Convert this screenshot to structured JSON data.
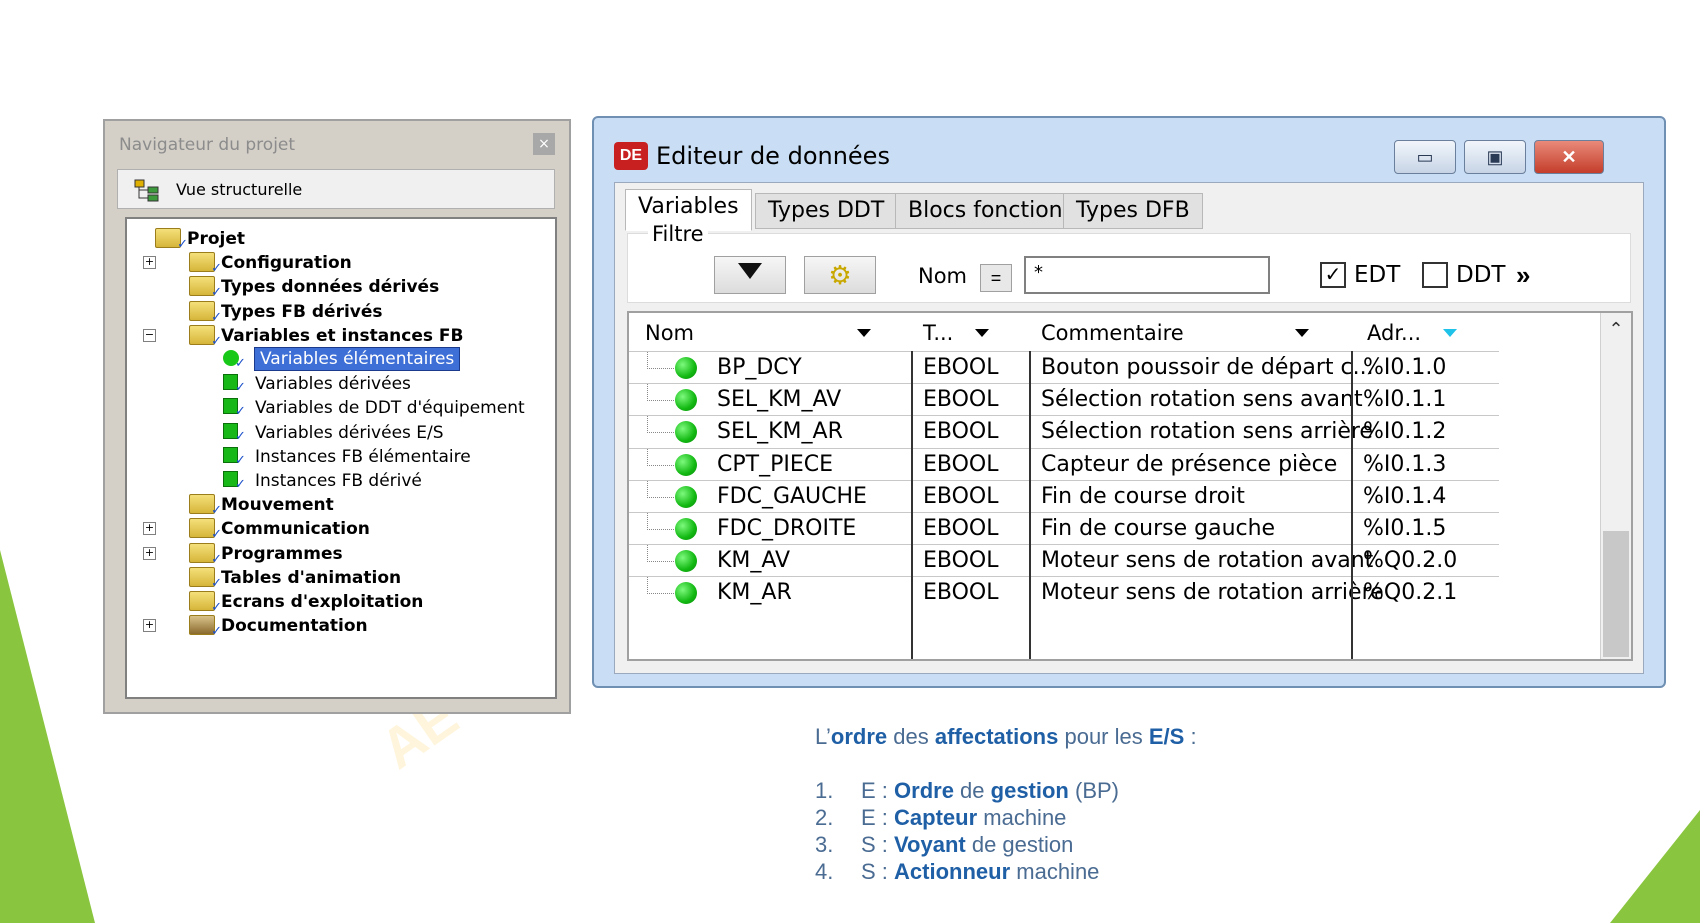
{
  "navigator": {
    "title": "Navigateur du projet",
    "close": "×",
    "view": "Vue structurelle",
    "tree": [
      {
        "label": "Projet",
        "bold": true,
        "level": 0,
        "icon": "folder-icon",
        "expander": ""
      },
      {
        "label": "Configuration",
        "bold": true,
        "level": 1,
        "icon": "folder-icon",
        "expander": "+"
      },
      {
        "label": "Types données dérivés",
        "bold": true,
        "level": 1,
        "icon": "folder-icon",
        "expander": ""
      },
      {
        "label": "Types FB dérivés",
        "bold": true,
        "level": 1,
        "icon": "folder-icon",
        "expander": ""
      },
      {
        "label": "Variables et instances FB",
        "bold": true,
        "level": 1,
        "icon": "folder-icon",
        "expander": "−"
      },
      {
        "label": "Variables élémentaires",
        "bold": false,
        "level": 2,
        "icon": "green-ball-icon",
        "selected": true
      },
      {
        "label": "Variables dérivées",
        "bold": false,
        "level": 2,
        "icon": "green-block-icon"
      },
      {
        "label": "Variables de DDT d'équipement",
        "bold": false,
        "level": 2,
        "icon": "green-block-icon"
      },
      {
        "label": "Variables dérivées E/S",
        "bold": false,
        "level": 2,
        "icon": "green-io-icon"
      },
      {
        "label": "Instances FB élémentaire",
        "bold": false,
        "level": 2,
        "icon": "green-fb-icon"
      },
      {
        "label": "Instances FB dérivé",
        "bold": false,
        "level": 2,
        "icon": "green-fb-icon"
      },
      {
        "label": "Mouvement",
        "bold": true,
        "level": 1,
        "icon": "folder-icon",
        "expander": ""
      },
      {
        "label": "Communication",
        "bold": true,
        "level": 1,
        "icon": "folder-icon",
        "expander": "+"
      },
      {
        "label": "Programmes",
        "bold": true,
        "level": 1,
        "icon": "folder-icon",
        "expander": "+"
      },
      {
        "label": "Tables d'animation",
        "bold": true,
        "level": 1,
        "icon": "folder-icon",
        "expander": ""
      },
      {
        "label": "Ecrans d'exploitation",
        "bold": true,
        "level": 1,
        "icon": "folder-icon",
        "expander": ""
      },
      {
        "label": "Documentation",
        "bold": true,
        "level": 1,
        "icon": "documentation-icon",
        "expander": "+"
      }
    ]
  },
  "editor": {
    "title": "Editeur de données",
    "app_icon": "DE",
    "buttons": {
      "minimize": "▭",
      "maximize": "▣",
      "close": "✕"
    },
    "tabs": [
      "Variables",
      "Types DDT",
      "Blocs fonction",
      "Types DFB"
    ],
    "filter": {
      "label": "Filtre",
      "nom_label": "Nom",
      "eq": "=",
      "value": "*",
      "edt_label": "EDT",
      "edt_checked": true,
      "ddt_label": "DDT",
      "ddt_checked": false,
      "more": "»"
    },
    "columns": [
      "Nom",
      "T...",
      "Commentaire",
      "Adr..."
    ],
    "rows": [
      {
        "name": "BP_DCY",
        "type": "EBOOL",
        "comment": "Bouton poussoir de départ c...",
        "addr": "%I0.1.0"
      },
      {
        "name": "SEL_KM_AV",
        "type": "EBOOL",
        "comment": "Sélection rotation sens avant",
        "addr": "%I0.1.1"
      },
      {
        "name": "SEL_KM_AR",
        "type": "EBOOL",
        "comment": "Sélection rotation sens arrière",
        "addr": "%I0.1.2"
      },
      {
        "name": "CPT_PIECE",
        "type": "EBOOL",
        "comment": "Capteur de présence pièce",
        "addr": "%I0.1.3"
      },
      {
        "name": "FDC_GAUCHE",
        "type": "EBOOL",
        "comment": "Fin de course droit",
        "addr": "%I0.1.4"
      },
      {
        "name": "FDC_DROITE",
        "type": "EBOOL",
        "comment": "Fin de course gauche",
        "addr": "%I0.1.5"
      },
      {
        "name": "KM_AV",
        "type": "EBOOL",
        "comment": "Moteur sens de rotation avant",
        "addr": "%Q0.2.0"
      },
      {
        "name": "KM_AR",
        "type": "EBOOL",
        "comment": "Moteur sens de rotation arrière",
        "addr": "%Q0.2.1"
      }
    ]
  },
  "caption": {
    "parts": [
      {
        "t": "L’",
        "b": false
      },
      {
        "t": "ordre",
        "b": true
      },
      {
        "t": " des ",
        "b": false
      },
      {
        "t": "affectations",
        "b": true
      },
      {
        "t": " pour les ",
        "b": false
      },
      {
        "t": "E/S",
        "b": true
      },
      {
        "t": " :",
        "b": false
      }
    ],
    "list": [
      {
        "num": "1.",
        "parts": [
          {
            "t": "E : ",
            "b": false
          },
          {
            "t": "Ordre",
            "b": true
          },
          {
            "t": " de ",
            "b": false
          },
          {
            "t": "gestion",
            "b": true
          },
          {
            "t": " (BP)",
            "b": false
          }
        ]
      },
      {
        "num": "2.",
        "parts": [
          {
            "t": "E : ",
            "b": false
          },
          {
            "t": "Capteur",
            "b": true
          },
          {
            "t": " machine",
            "b": false
          }
        ]
      },
      {
        "num": "3.",
        "parts": [
          {
            "t": "S : ",
            "b": false
          },
          {
            "t": "Voyant",
            "b": true
          },
          {
            "t": "  de gestion",
            "b": false
          }
        ]
      },
      {
        "num": "4.",
        "parts": [
          {
            "t": "S : ",
            "b": false
          },
          {
            "t": "Actionneur",
            "b": true
          },
          {
            "t": " machine",
            "b": false
          }
        ]
      }
    ]
  },
  "watermark": "AE",
  "colors": {
    "accent": "#1f5fa6",
    "deco": "#8ac53f",
    "selection": "#3d6fd6"
  }
}
